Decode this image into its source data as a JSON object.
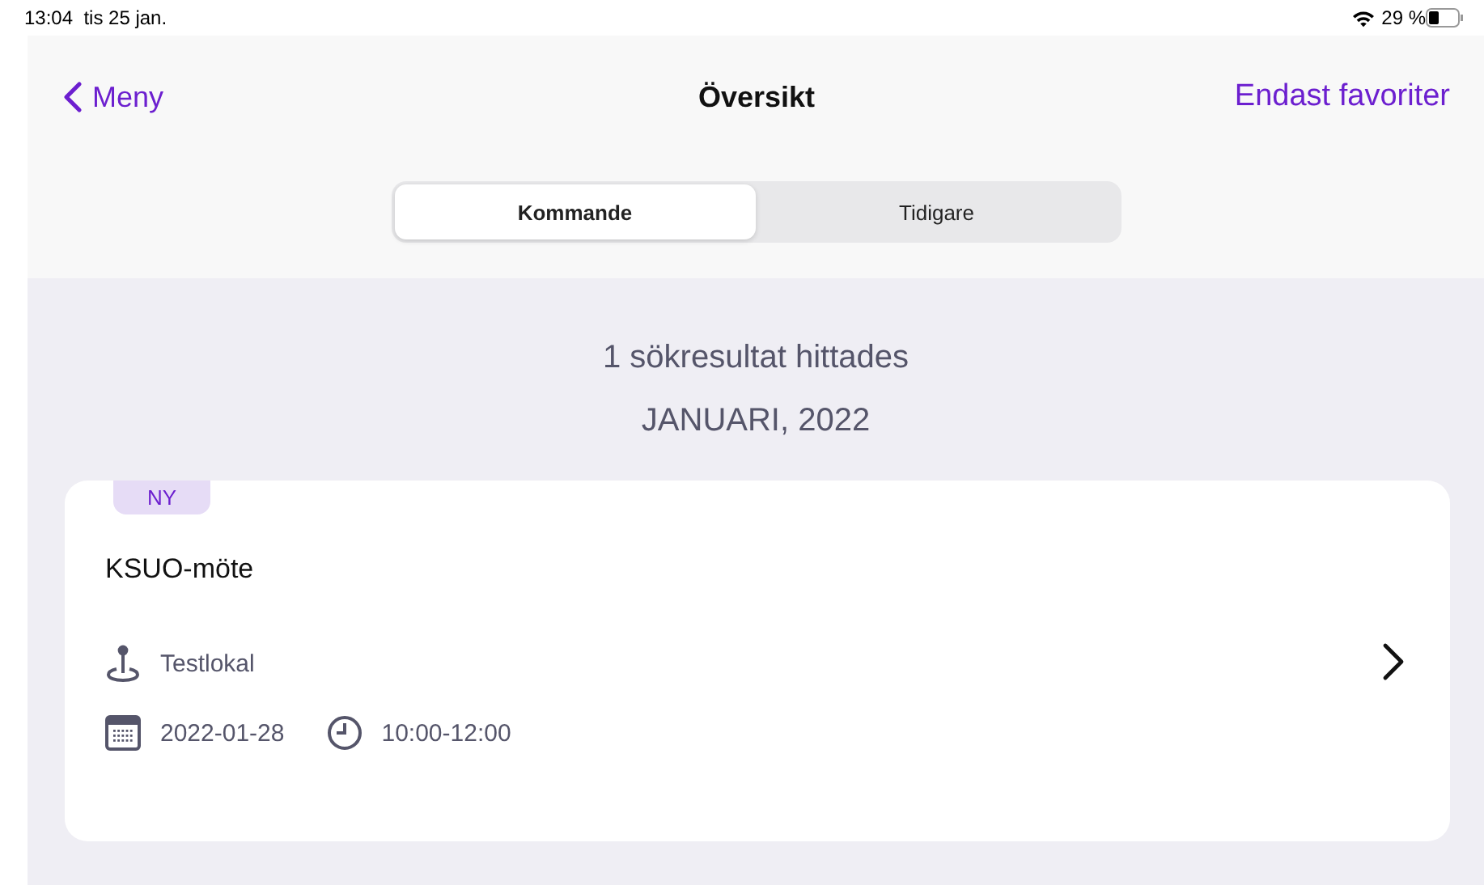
{
  "status_bar": {
    "time": "13:04",
    "date": "tis 25 jan.",
    "battery": "29 %"
  },
  "nav": {
    "back": "Meny",
    "title": "Översikt",
    "action": "Endast favoriter"
  },
  "tabs": [
    {
      "label": "Kommande",
      "selected": true
    },
    {
      "label": "Tidigare",
      "selected": false
    }
  ],
  "summary": "1 sökresultat hittades",
  "month": "JANUARI, 2022",
  "events": [
    {
      "badge": "NY",
      "title": "KSUO-möte",
      "location": "Testlokal",
      "date": "2022-01-28",
      "time": "10:00-12:00"
    }
  ]
}
